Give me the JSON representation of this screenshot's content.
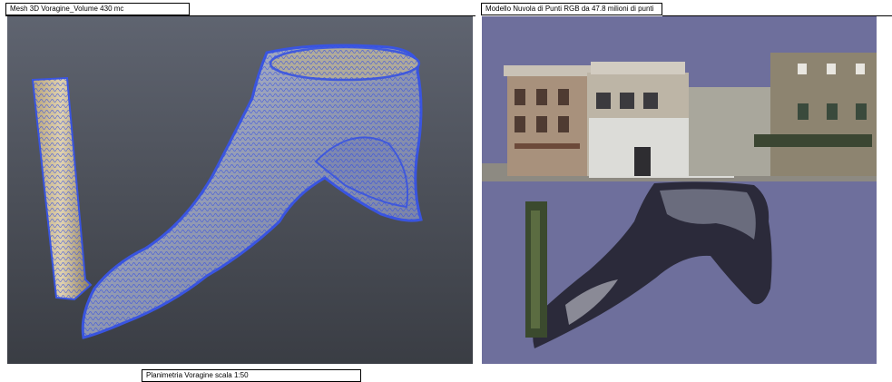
{
  "captions": {
    "left": "Mesh 3D Voragine_Volume 430 mc",
    "right": "Modello Nuvola di Punti RGB da 47.8 milioni di punti",
    "bottom": "Planimetria Voragine scala 1:50"
  },
  "colors": {
    "left_panel_bg": "#4c5059",
    "mesh_wire": "#3a55e0",
    "mesh_surface": "#9aa2b8",
    "right_panel_bg": "#6e6f9c"
  }
}
